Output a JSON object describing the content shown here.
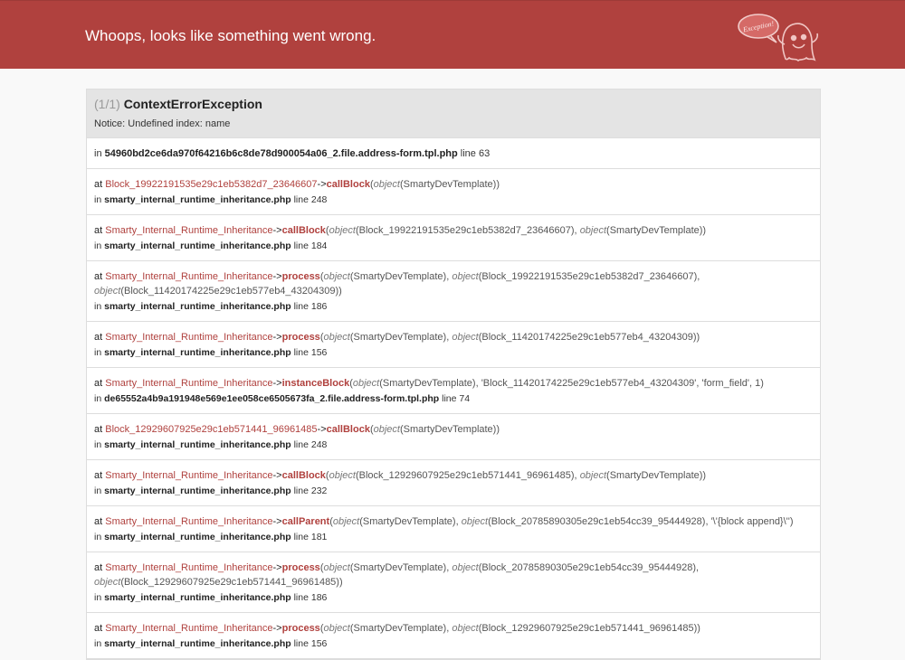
{
  "header": {
    "title": "Whoops, looks like something went wrong.",
    "logo_text": "Exception!"
  },
  "exception": {
    "count": "(1/1)",
    "name": "ContextErrorException",
    "message": "Notice: Undefined index: name"
  },
  "labels": {
    "in": "in",
    "at": "at",
    "line": "line",
    "arrow": "->"
  },
  "first_location": {
    "file": "54960bd2ce6da970f64216b6c8de78d900054a06_2.file.address-form.tpl.php",
    "line": "63"
  },
  "frames": [
    {
      "class": "Block_19922191535e29c1eb5382d7_23646607",
      "method": "callBlock",
      "args_text": "(object(SmartyDevTemplate))",
      "file": "smarty_internal_runtime_inheritance.php",
      "line": "248"
    },
    {
      "class": "Smarty_Internal_Runtime_Inheritance",
      "method": "callBlock",
      "args_text": "(object(Block_19922191535e29c1eb5382d7_23646607), object(SmartyDevTemplate))",
      "file": "smarty_internal_runtime_inheritance.php",
      "line": "184"
    },
    {
      "class": "Smarty_Internal_Runtime_Inheritance",
      "method": "process",
      "args_text": "(object(SmartyDevTemplate), object(Block_19922191535e29c1eb5382d7_23646607), object(Block_11420174225e29c1eb577eb4_43204309))",
      "file": "smarty_internal_runtime_inheritance.php",
      "line": "186"
    },
    {
      "class": "Smarty_Internal_Runtime_Inheritance",
      "method": "process",
      "args_text": "(object(SmartyDevTemplate), object(Block_11420174225e29c1eb577eb4_43204309))",
      "file": "smarty_internal_runtime_inheritance.php",
      "line": "156"
    },
    {
      "class": "Smarty_Internal_Runtime_Inheritance",
      "method": "instanceBlock",
      "args_text": "(object(SmartyDevTemplate), 'Block_11420174225e29c1eb577eb4_43204309', 'form_field', 1)",
      "file": "de65552a4b9a191948e569e1ee058ce6505673fa_2.file.address-form.tpl.php",
      "line": "74"
    },
    {
      "class": "Block_12929607925e29c1eb571441_96961485",
      "method": "callBlock",
      "args_text": "(object(SmartyDevTemplate))",
      "file": "smarty_internal_runtime_inheritance.php",
      "line": "248"
    },
    {
      "class": "Smarty_Internal_Runtime_Inheritance",
      "method": "callBlock",
      "args_text": "(object(Block_12929607925e29c1eb571441_96961485), object(SmartyDevTemplate))",
      "file": "smarty_internal_runtime_inheritance.php",
      "line": "232"
    },
    {
      "class": "Smarty_Internal_Runtime_Inheritance",
      "method": "callParent",
      "args_text": "(object(SmartyDevTemplate), object(Block_20785890305e29c1eb54cc39_95444928), '\\'{block append}\\'')",
      "file": "smarty_internal_runtime_inheritance.php",
      "line": "181"
    },
    {
      "class": "Smarty_Internal_Runtime_Inheritance",
      "method": "process",
      "args_text": "(object(SmartyDevTemplate), object(Block_20785890305e29c1eb54cc39_95444928), object(Block_12929607925e29c1eb571441_96961485))",
      "file": "smarty_internal_runtime_inheritance.php",
      "line": "186"
    },
    {
      "class": "Smarty_Internal_Runtime_Inheritance",
      "method": "process",
      "args_text": "(object(SmartyDevTemplate), object(Block_12929607925e29c1eb571441_96961485))",
      "file": "smarty_internal_runtime_inheritance.php",
      "line": "156"
    }
  ]
}
